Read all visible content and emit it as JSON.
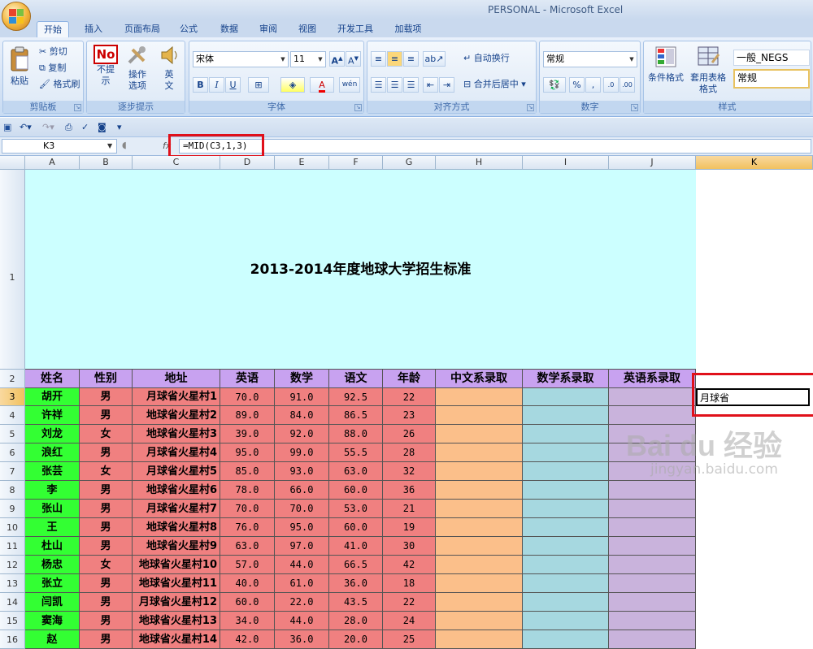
{
  "app_title": "PERSONAL - Microsoft Excel",
  "tabs": [
    "开始",
    "插入",
    "页面布局",
    "公式",
    "数据",
    "审阅",
    "视图",
    "开发工具",
    "加载项"
  ],
  "ribbon": {
    "clipboard": {
      "paste": "粘贴",
      "cut": "剪切",
      "copy": "复制",
      "format_painter": "格式刷",
      "label": "剪贴板"
    },
    "step_hint": {
      "no_prompt": "不提示",
      "op_options": "操作选项",
      "english": "英文",
      "label": "逐步提示"
    },
    "font": {
      "name": "宋体",
      "size": "11",
      "label": "字体"
    },
    "alignment": {
      "wrap": "自动换行",
      "merge": "合并后居中",
      "label": "对齐方式"
    },
    "number": {
      "format": "常规",
      "label": "数字"
    },
    "styles": {
      "conditional": "条件格式",
      "table_format": "套用表格格式",
      "style1": "一般_NEGS",
      "style2": "常规",
      "label": "样式"
    }
  },
  "formula_bar": {
    "name_box": "K3",
    "formula": "=MID(C3,1,3)"
  },
  "sheet": {
    "columns": [
      "A",
      "B",
      "C",
      "D",
      "E",
      "F",
      "G",
      "H",
      "I",
      "J",
      "K"
    ],
    "title": "2013-2014年度地球大学招生标准",
    "headers": [
      "姓名",
      "性别",
      "地址",
      "英语",
      "数学",
      "语文",
      "年龄",
      "中文系录取",
      "数学系录取",
      "英语系录取"
    ],
    "rows": [
      [
        "胡开",
        "男",
        "月球省火星村1",
        "70.0",
        "91.0",
        "92.5",
        "22"
      ],
      [
        "许祥",
        "男",
        "地球省火星村2",
        "89.0",
        "84.0",
        "86.5",
        "23"
      ],
      [
        "刘龙",
        "女",
        "地球省火星村3",
        "39.0",
        "92.0",
        "88.0",
        "26"
      ],
      [
        "浪红",
        "男",
        "月球省火星村4",
        "95.0",
        "99.0",
        "55.5",
        "28"
      ],
      [
        "张芸",
        "女",
        "月球省火星村5",
        "85.0",
        "93.0",
        "63.0",
        "32"
      ],
      [
        "李",
        "男",
        "地球省火星村6",
        "78.0",
        "66.0",
        "60.0",
        "36"
      ],
      [
        "张山",
        "男",
        "月球省火星村7",
        "70.0",
        "70.0",
        "53.0",
        "21"
      ],
      [
        "王",
        "男",
        "地球省火星村8",
        "76.0",
        "95.0",
        "60.0",
        "19"
      ],
      [
        "杜山",
        "男",
        "地球省火星村9",
        "63.0",
        "97.0",
        "41.0",
        "30"
      ],
      [
        "杨忠",
        "女",
        "地球省火星村10",
        "57.0",
        "44.0",
        "66.5",
        "42"
      ],
      [
        "张立",
        "男",
        "地球省火星村11",
        "40.0",
        "61.0",
        "36.0",
        "18"
      ],
      [
        "闫凯",
        "男",
        "月球省火星村12",
        "60.0",
        "22.0",
        "43.5",
        "22"
      ],
      [
        "窦海",
        "男",
        "地球省火星村13",
        "34.0",
        "44.0",
        "28.0",
        "24"
      ],
      [
        "赵",
        "男",
        "地球省火星村14",
        "42.0",
        "36.0",
        "20.0",
        "25"
      ]
    ],
    "row_numbers": [
      "1",
      "2",
      "3",
      "4",
      "5",
      "6",
      "7",
      "8",
      "9",
      "10",
      "11",
      "12",
      "13",
      "14",
      "15",
      "16"
    ],
    "k3_value": "月球省"
  },
  "watermark": {
    "brand": "Bai du 经验",
    "url": "jingyan.baidu.com"
  },
  "colors": {
    "green": "#33ff33",
    "pink": "#f08080",
    "lavender": "#c8a2f0",
    "peach": "#fbbf8a",
    "lightblue": "#a6d8e0",
    "mauve": "#c9b3dc",
    "title_bg": "#ccffff",
    "red_highlight": "#e0101a"
  }
}
